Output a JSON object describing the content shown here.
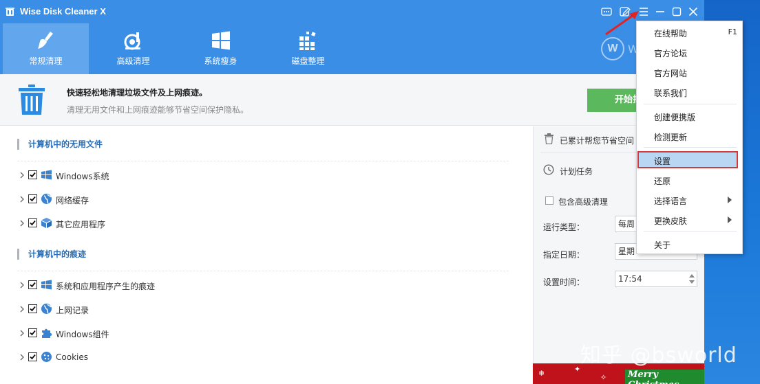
{
  "window": {
    "title": "Wise Disk Cleaner X"
  },
  "tabs": [
    {
      "label": "常规清理",
      "icon": "broom-icon"
    },
    {
      "label": "高级清理",
      "icon": "vacuum-icon"
    },
    {
      "label": "系统瘦身",
      "icon": "windows-logo-icon"
    },
    {
      "label": "磁盘整理",
      "icon": "defrag-icon"
    }
  ],
  "brand": {
    "logo_letter": "W",
    "logo_text": "W"
  },
  "banner": {
    "title": "快速轻松地清理垃圾文件及上网痕迹。",
    "subtitle": "清理无用文件和上网痕迹能够节省空间保护隐私。",
    "start_button": "开始扫"
  },
  "sections": [
    {
      "heading": "计算机中的无用文件",
      "items": [
        {
          "label": "Windows系统",
          "icon": "windows-icon",
          "checked": true
        },
        {
          "label": "网络缓存",
          "icon": "globe-icon",
          "checked": true
        },
        {
          "label": "其它应用程序",
          "icon": "box-icon",
          "checked": true
        }
      ]
    },
    {
      "heading": "计算机中的痕迹",
      "items": [
        {
          "label": "系统和应用程序产生的痕迹",
          "icon": "windows-icon",
          "checked": true
        },
        {
          "label": "上网记录",
          "icon": "globe-icon",
          "checked": true
        },
        {
          "label": "Windows组件",
          "icon": "puzzle-icon",
          "checked": true
        },
        {
          "label": "Cookies",
          "icon": "cookie-icon",
          "checked": true
        }
      ]
    }
  ],
  "right_panel": {
    "saved_text": "已累计帮您节省空间",
    "schedule_title": "计划任务",
    "include_advanced": "包含高级清理",
    "run_type_label": "运行类型：",
    "run_type_value": "每周",
    "date_label": "指定日期：",
    "date_value": "星期",
    "time_label": "设置时间：",
    "time_value": "17:54",
    "promo_text": "Merry Christmas"
  },
  "menu": {
    "items": [
      {
        "label": "在线帮助",
        "shortcut": "F1"
      },
      {
        "label": "官方论坛"
      },
      {
        "label": "官方网站"
      },
      {
        "label": "联系我们"
      },
      {
        "label": "创建便携版"
      },
      {
        "label": "检测更新"
      },
      {
        "label": "设置",
        "selected": true
      },
      {
        "label": "还原"
      },
      {
        "label": "选择语言",
        "submenu": true
      },
      {
        "label": "更换皮肤",
        "submenu": true
      },
      {
        "label": "关于"
      }
    ]
  },
  "watermark": "知乎 @bsworld",
  "colors": {
    "title_bar": "#3a8ee6",
    "active_tab": "#62a6ee",
    "start_button": "#5cb85c",
    "section_heading": "#2c6fb4",
    "menu_highlight": "#b9d7f2",
    "highlight_border": "#d23a3a"
  }
}
